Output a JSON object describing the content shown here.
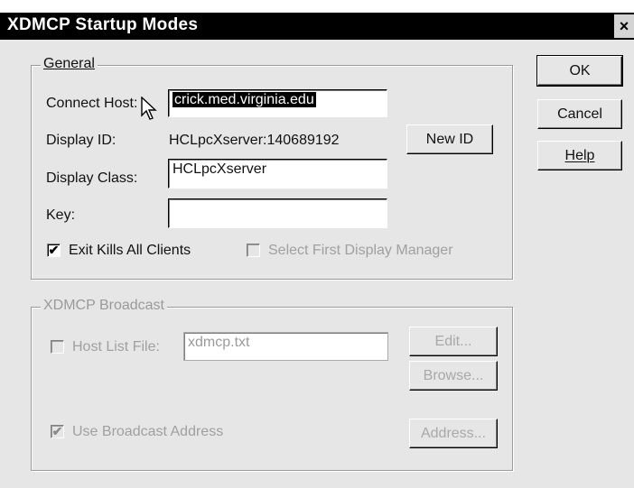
{
  "window": {
    "title": "XDMCP Startup Modes",
    "close_glyph": "×"
  },
  "general": {
    "legend": "General",
    "connect_host_label": "Connect Host:",
    "connect_host_value": "crick.med.virginia.edu",
    "display_id_label": "Display ID:",
    "display_id_value": "HCLpcXserver:140689192",
    "new_id_label": "New ID",
    "display_class_label": "Display Class:",
    "display_class_value": "HCLpcXserver",
    "key_label": "Key:",
    "key_value": "",
    "exit_kills_label": "Exit Kills All Clients",
    "exit_kills_checked": true,
    "select_first_label": "Select First Display Manager",
    "select_first_checked": false
  },
  "broadcast": {
    "legend": "XDMCP Broadcast",
    "host_list_label": "Host List File:",
    "host_list_value": "xdmcp.txt",
    "host_list_checked": false,
    "edit_label": "Edit...",
    "browse_label": "Browse...",
    "use_broadcast_label": "Use Broadcast Address",
    "use_broadcast_checked": true,
    "address_label": "Address..."
  },
  "buttons": {
    "ok_label": "OK",
    "cancel_label": "Cancel",
    "help_label": "Help"
  },
  "icons": {
    "checkmark": "✔",
    "cursor": "mouse-pointer-icon"
  }
}
